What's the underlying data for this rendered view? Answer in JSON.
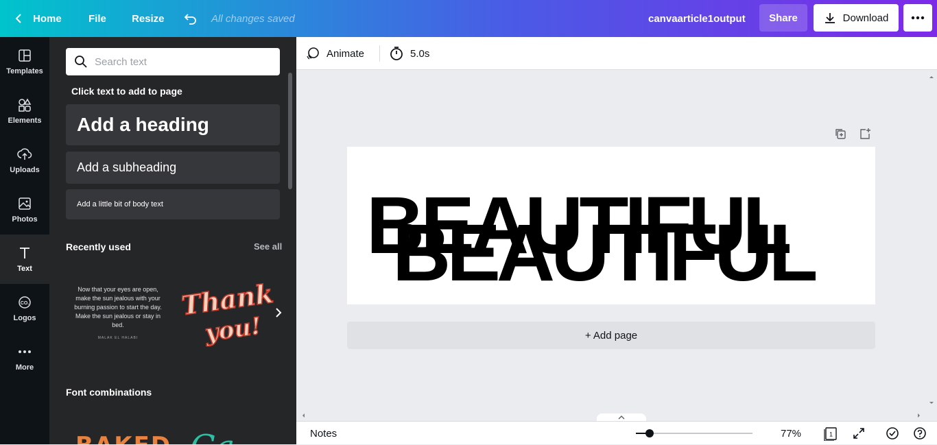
{
  "topbar": {
    "home": "Home",
    "file": "File",
    "resize": "Resize",
    "saved_status": "All changes saved",
    "doc_title": "canvaarticle1output",
    "share": "Share",
    "download": "Download"
  },
  "rail": {
    "items": [
      {
        "label": "Templates",
        "icon": "templates-icon"
      },
      {
        "label": "Elements",
        "icon": "elements-icon"
      },
      {
        "label": "Uploads",
        "icon": "upload-icon"
      },
      {
        "label": "Photos",
        "icon": "photo-icon"
      },
      {
        "label": "Text",
        "icon": "text-icon"
      },
      {
        "label": "Logos",
        "icon": "logo-icon"
      },
      {
        "label": "More",
        "icon": "more-icon"
      }
    ]
  },
  "panel": {
    "search_placeholder": "Search text",
    "click_text": "Click text to add to page",
    "add_heading": "Add a heading",
    "add_subheading": "Add a subheading",
    "add_body": "Add a little bit of body text",
    "recently_used": "Recently used",
    "see_all": "See all",
    "quote_text": "Now that your eyes are open, make the sun jealous with your burning passion to start the day. Make the sun jealous or stay in bed.",
    "quote_author": "MALAK EL HALABI",
    "thank_you_line1": "Thank",
    "thank_you_line2": "you!",
    "font_combinations": "Font combinations",
    "combo1": "BAKED",
    "combo2": "Ca"
  },
  "toolbar": {
    "animate": "Animate",
    "duration": "5.0s"
  },
  "canvas": {
    "word1": "BEAUTIFUL",
    "word2": "BEAUTIFUL",
    "add_page": "+ Add page"
  },
  "bottombar": {
    "notes": "Notes",
    "zoom": "77%",
    "zoom_fraction": 0.12,
    "page_count": "1"
  },
  "colors": {
    "accent_start": "#00c4cc",
    "accent_end": "#7d2ae8",
    "panel_bg": "#252627",
    "rail_bg": "#0e1318"
  }
}
